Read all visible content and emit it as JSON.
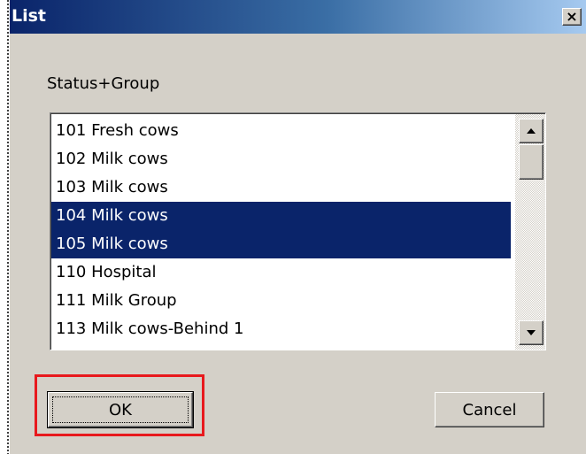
{
  "window": {
    "title": "List",
    "close_glyph": "×"
  },
  "field": {
    "label": "Status+Group"
  },
  "listbox": {
    "items": [
      {
        "label": "101 Fresh cows",
        "selected": false
      },
      {
        "label": "102 Milk cows",
        "selected": false
      },
      {
        "label": "103 Milk cows",
        "selected": false
      },
      {
        "label": "104 Milk cows",
        "selected": true
      },
      {
        "label": "105 Milk cows",
        "selected": true
      },
      {
        "label": "110 Hospital",
        "selected": false
      },
      {
        "label": "111 Milk Group",
        "selected": false
      },
      {
        "label": "113 Milk cows-Behind 1",
        "selected": false
      }
    ]
  },
  "buttons": {
    "ok_label": "OK",
    "cancel_label": "Cancel"
  },
  "annotation": {
    "highlight_color": "#e8191d",
    "target": "ok-button"
  },
  "colors": {
    "titlebar_start": "#0a246a",
    "titlebar_end": "#a6caf0",
    "selection_bg": "#0a246a",
    "dialog_bg": "#d4d0c8"
  }
}
